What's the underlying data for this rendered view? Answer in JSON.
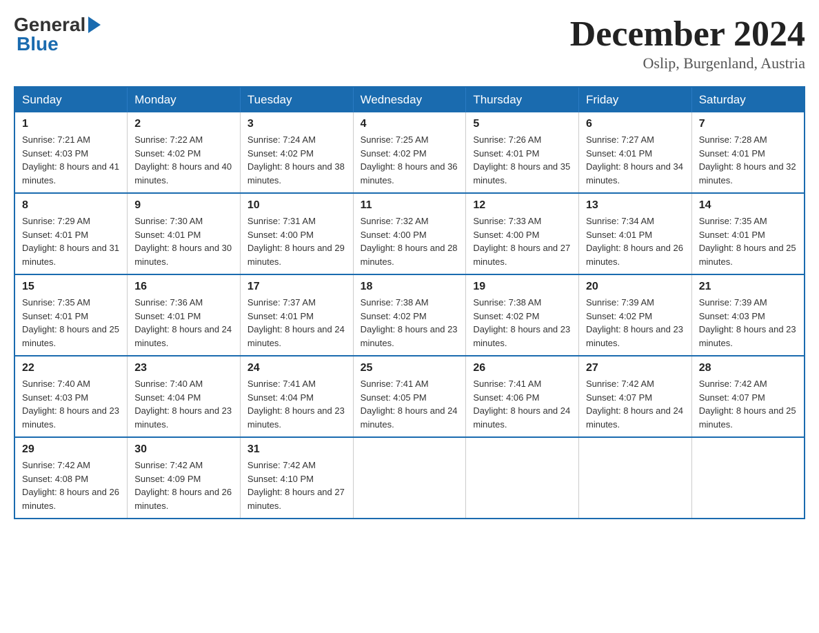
{
  "logo": {
    "general": "General",
    "blue": "Blue"
  },
  "header": {
    "month_title": "December 2024",
    "location": "Oslip, Burgenland, Austria"
  },
  "days_of_week": [
    "Sunday",
    "Monday",
    "Tuesday",
    "Wednesday",
    "Thursday",
    "Friday",
    "Saturday"
  ],
  "weeks": [
    [
      {
        "day": "1",
        "sunrise": "Sunrise: 7:21 AM",
        "sunset": "Sunset: 4:03 PM",
        "daylight": "Daylight: 8 hours and 41 minutes."
      },
      {
        "day": "2",
        "sunrise": "Sunrise: 7:22 AM",
        "sunset": "Sunset: 4:02 PM",
        "daylight": "Daylight: 8 hours and 40 minutes."
      },
      {
        "day": "3",
        "sunrise": "Sunrise: 7:24 AM",
        "sunset": "Sunset: 4:02 PM",
        "daylight": "Daylight: 8 hours and 38 minutes."
      },
      {
        "day": "4",
        "sunrise": "Sunrise: 7:25 AM",
        "sunset": "Sunset: 4:02 PM",
        "daylight": "Daylight: 8 hours and 36 minutes."
      },
      {
        "day": "5",
        "sunrise": "Sunrise: 7:26 AM",
        "sunset": "Sunset: 4:01 PM",
        "daylight": "Daylight: 8 hours and 35 minutes."
      },
      {
        "day": "6",
        "sunrise": "Sunrise: 7:27 AM",
        "sunset": "Sunset: 4:01 PM",
        "daylight": "Daylight: 8 hours and 34 minutes."
      },
      {
        "day": "7",
        "sunrise": "Sunrise: 7:28 AM",
        "sunset": "Sunset: 4:01 PM",
        "daylight": "Daylight: 8 hours and 32 minutes."
      }
    ],
    [
      {
        "day": "8",
        "sunrise": "Sunrise: 7:29 AM",
        "sunset": "Sunset: 4:01 PM",
        "daylight": "Daylight: 8 hours and 31 minutes."
      },
      {
        "day": "9",
        "sunrise": "Sunrise: 7:30 AM",
        "sunset": "Sunset: 4:01 PM",
        "daylight": "Daylight: 8 hours and 30 minutes."
      },
      {
        "day": "10",
        "sunrise": "Sunrise: 7:31 AM",
        "sunset": "Sunset: 4:00 PM",
        "daylight": "Daylight: 8 hours and 29 minutes."
      },
      {
        "day": "11",
        "sunrise": "Sunrise: 7:32 AM",
        "sunset": "Sunset: 4:00 PM",
        "daylight": "Daylight: 8 hours and 28 minutes."
      },
      {
        "day": "12",
        "sunrise": "Sunrise: 7:33 AM",
        "sunset": "Sunset: 4:00 PM",
        "daylight": "Daylight: 8 hours and 27 minutes."
      },
      {
        "day": "13",
        "sunrise": "Sunrise: 7:34 AM",
        "sunset": "Sunset: 4:01 PM",
        "daylight": "Daylight: 8 hours and 26 minutes."
      },
      {
        "day": "14",
        "sunrise": "Sunrise: 7:35 AM",
        "sunset": "Sunset: 4:01 PM",
        "daylight": "Daylight: 8 hours and 25 minutes."
      }
    ],
    [
      {
        "day": "15",
        "sunrise": "Sunrise: 7:35 AM",
        "sunset": "Sunset: 4:01 PM",
        "daylight": "Daylight: 8 hours and 25 minutes."
      },
      {
        "day": "16",
        "sunrise": "Sunrise: 7:36 AM",
        "sunset": "Sunset: 4:01 PM",
        "daylight": "Daylight: 8 hours and 24 minutes."
      },
      {
        "day": "17",
        "sunrise": "Sunrise: 7:37 AM",
        "sunset": "Sunset: 4:01 PM",
        "daylight": "Daylight: 8 hours and 24 minutes."
      },
      {
        "day": "18",
        "sunrise": "Sunrise: 7:38 AM",
        "sunset": "Sunset: 4:02 PM",
        "daylight": "Daylight: 8 hours and 23 minutes."
      },
      {
        "day": "19",
        "sunrise": "Sunrise: 7:38 AM",
        "sunset": "Sunset: 4:02 PM",
        "daylight": "Daylight: 8 hours and 23 minutes."
      },
      {
        "day": "20",
        "sunrise": "Sunrise: 7:39 AM",
        "sunset": "Sunset: 4:02 PM",
        "daylight": "Daylight: 8 hours and 23 minutes."
      },
      {
        "day": "21",
        "sunrise": "Sunrise: 7:39 AM",
        "sunset": "Sunset: 4:03 PM",
        "daylight": "Daylight: 8 hours and 23 minutes."
      }
    ],
    [
      {
        "day": "22",
        "sunrise": "Sunrise: 7:40 AM",
        "sunset": "Sunset: 4:03 PM",
        "daylight": "Daylight: 8 hours and 23 minutes."
      },
      {
        "day": "23",
        "sunrise": "Sunrise: 7:40 AM",
        "sunset": "Sunset: 4:04 PM",
        "daylight": "Daylight: 8 hours and 23 minutes."
      },
      {
        "day": "24",
        "sunrise": "Sunrise: 7:41 AM",
        "sunset": "Sunset: 4:04 PM",
        "daylight": "Daylight: 8 hours and 23 minutes."
      },
      {
        "day": "25",
        "sunrise": "Sunrise: 7:41 AM",
        "sunset": "Sunset: 4:05 PM",
        "daylight": "Daylight: 8 hours and 24 minutes."
      },
      {
        "day": "26",
        "sunrise": "Sunrise: 7:41 AM",
        "sunset": "Sunset: 4:06 PM",
        "daylight": "Daylight: 8 hours and 24 minutes."
      },
      {
        "day": "27",
        "sunrise": "Sunrise: 7:42 AM",
        "sunset": "Sunset: 4:07 PM",
        "daylight": "Daylight: 8 hours and 24 minutes."
      },
      {
        "day": "28",
        "sunrise": "Sunrise: 7:42 AM",
        "sunset": "Sunset: 4:07 PM",
        "daylight": "Daylight: 8 hours and 25 minutes."
      }
    ],
    [
      {
        "day": "29",
        "sunrise": "Sunrise: 7:42 AM",
        "sunset": "Sunset: 4:08 PM",
        "daylight": "Daylight: 8 hours and 26 minutes."
      },
      {
        "day": "30",
        "sunrise": "Sunrise: 7:42 AM",
        "sunset": "Sunset: 4:09 PM",
        "daylight": "Daylight: 8 hours and 26 minutes."
      },
      {
        "day": "31",
        "sunrise": "Sunrise: 7:42 AM",
        "sunset": "Sunset: 4:10 PM",
        "daylight": "Daylight: 8 hours and 27 minutes."
      },
      null,
      null,
      null,
      null
    ]
  ]
}
